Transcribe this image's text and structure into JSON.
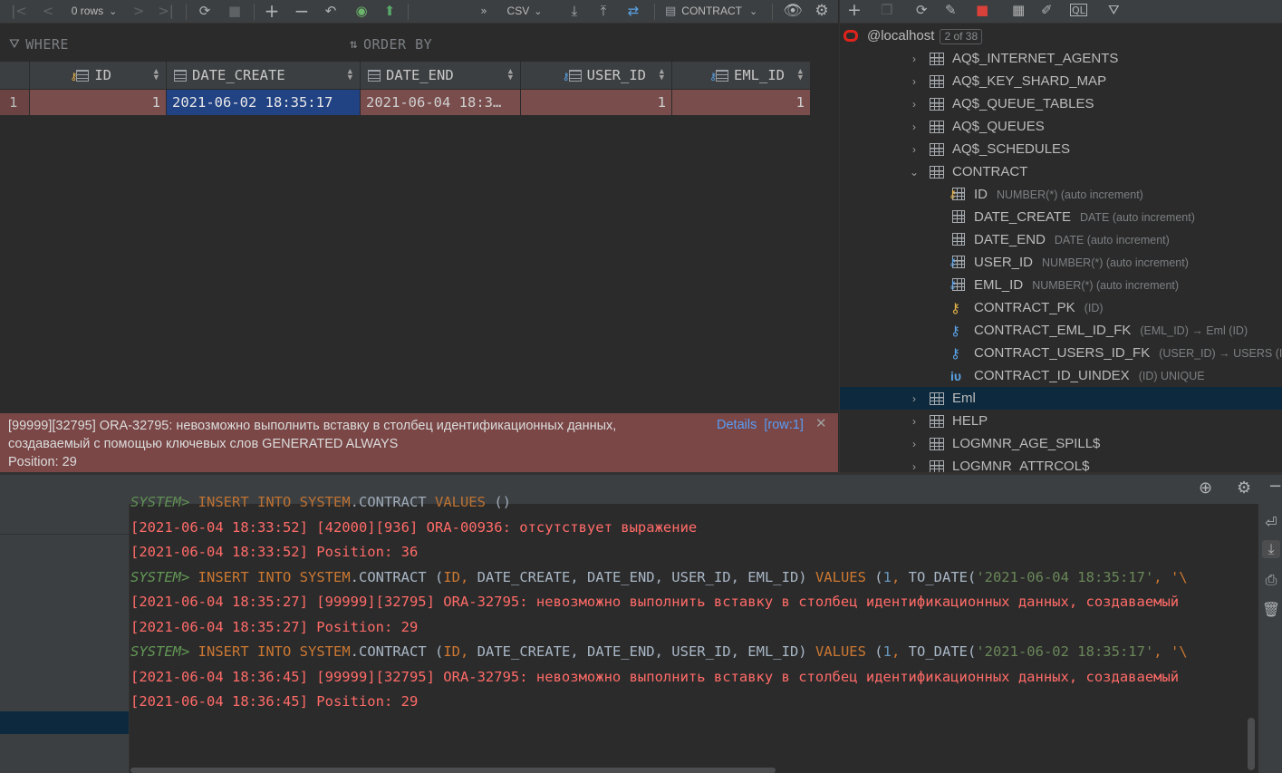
{
  "grid_toolbar": {
    "rows_label": "0 rows",
    "format_label": "CSV",
    "table_label": "CONTRACT"
  },
  "filter": {
    "where_placeholder": "WHERE",
    "order_placeholder": "ORDER BY"
  },
  "grid": {
    "columns": [
      "ID",
      "DATE_CREATE",
      "DATE_END",
      "USER_ID",
      "EML_ID"
    ],
    "row_number": "1",
    "row": [
      "1",
      "2021-06-02 18:35:17",
      "2021-06-04 18:3…",
      "1",
      "1"
    ]
  },
  "error": {
    "line1": "[99999][32795] ORA-32795: невозможно выполнить вставку в столбец идентификационных данных,",
    "line2": "создаваемый с помощью ключевых слов GENERATED ALWAYS",
    "line3": "Position: 29",
    "details_link": "Details",
    "row_link": "[row:1]",
    "close": "✕"
  },
  "db_tree": {
    "connection": "@localhost",
    "schema_badge": "2 of 38",
    "tables_before": [
      "AQ$_INTERNET_AGENTS",
      "AQ$_KEY_SHARD_MAP",
      "AQ$_QUEUE_TABLES",
      "AQ$_QUEUES",
      "AQ$_SCHEDULES"
    ],
    "expanded_table": "CONTRACT",
    "columns": [
      {
        "name": "ID",
        "meta": "NUMBER(*) (auto increment)"
      },
      {
        "name": "DATE_CREATE",
        "meta": "DATE (auto increment)"
      },
      {
        "name": "DATE_END",
        "meta": "DATE (auto increment)"
      },
      {
        "name": "USER_ID",
        "meta": "NUMBER(*) (auto increment)"
      },
      {
        "name": "EML_ID",
        "meta": "NUMBER(*) (auto increment)"
      }
    ],
    "keys": [
      {
        "name": "CONTRACT_PK",
        "meta": "(ID)"
      },
      {
        "name": "CONTRACT_EML_ID_FK",
        "meta": "(EML_ID) → Eml (ID)"
      },
      {
        "name": "CONTRACT_USERS_ID_FK",
        "meta": "(USER_ID) → USERS (ID)"
      },
      {
        "name": "CONTRACT_ID_UINDEX",
        "meta": "(ID) UNIQUE"
      }
    ],
    "tables_after": [
      "Eml",
      "HELP",
      "LOGMNR_AGE_SPILL$",
      "LOGMNR_ATTRCOL$"
    ]
  },
  "console": {
    "cut_line": "SYSTEM> INSERT INTO SYSTEM.CONTRACT VALUES ()",
    "err1": "[2021-06-04 18:33:52] [42000][936] ORA-00936: отсутствует выражение",
    "pos1": "[2021-06-04 18:33:52] Position: 36",
    "prompt": "SYSTEM>",
    "q1": {
      "insert": "INSERT INTO",
      "schema": "SYSTEM",
      "table_part": ".CONTRACT (",
      "col_id": "ID",
      "cols_rest": "DATE_CREATE, DATE_END, USER_ID, EML_ID)",
      "values_kw": "VALUES",
      "open": " (",
      "num": "1",
      "fn": "TO_DATE(",
      "str": "'2021-06-04 18:35:17'",
      "tail": ", '\\"
    },
    "err2": "[2021-06-04 18:35:27] [99999][32795] ORA-32795: невозможно выполнить вставку в столбец идентификационных данных, создаваемый",
    "pos2": "[2021-06-04 18:35:27] Position: 29",
    "q2": {
      "str": "'2021-06-02 18:35:17'"
    },
    "err3": "[2021-06-04 18:36:45] [99999][32795] ORA-32795: невозможно выполнить вставку в столбец идентификационных данных, создаваемый",
    "pos3": "[2021-06-04 18:36:45] Position: 29"
  }
}
